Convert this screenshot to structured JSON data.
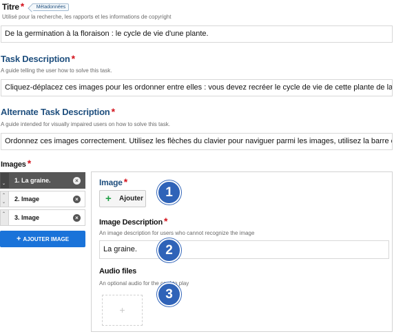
{
  "title_field": {
    "label": "Titre",
    "badge": "Métadonnées",
    "description": "Utilisé pour la recherche, les rapports et les informations de copyright",
    "value": "De la germination à la floraison : le cycle de vie d'une plante."
  },
  "task_description": {
    "label": "Task Description",
    "description": "A guide telling the user how to solve this task.",
    "value": "Cliquez-déplacez ces images pour les ordonner entre elles : vous devez recréer le cycle de vie de cette plante de la germinati"
  },
  "alternate_task_description": {
    "label": "Alternate Task Description",
    "description": "A guide intended for visually impaired users on how to solve this task.",
    "value": "Ordonnez ces images correctement. Utilisez les flèches du clavier pour naviguer parmi les images, utilisez la barre espace pou"
  },
  "images": {
    "label": "Images",
    "items": [
      {
        "label": "1. La graine.",
        "active": true
      },
      {
        "label": "2. Image",
        "active": false
      },
      {
        "label": "3. Image",
        "active": false
      }
    ],
    "add_button_label": "AJOUTER IMAGE"
  },
  "editor": {
    "image_label": "Image",
    "add_label": "Ajouter",
    "image_description_label": "Image Description",
    "image_description_help": "An image description for users who cannot recognize the image",
    "image_description_value": "La graine.",
    "audio_label": "Audio files",
    "audio_help": "An optional audio for the card to play",
    "audio_add_symbol": "+"
  },
  "markers": [
    "1",
    "2",
    "3"
  ],
  "icons": {
    "required": "asterisk",
    "remove": "close-icon",
    "plus": "plus-icon",
    "drag": "chevron-up-down-icon"
  },
  "colors": {
    "required": "#d3121c",
    "label_blue": "#1f4f7e",
    "primary_button": "#1a73d9",
    "active_item": "#575757",
    "marker": "#2f63b8",
    "add_plus": "#1f9f45"
  }
}
